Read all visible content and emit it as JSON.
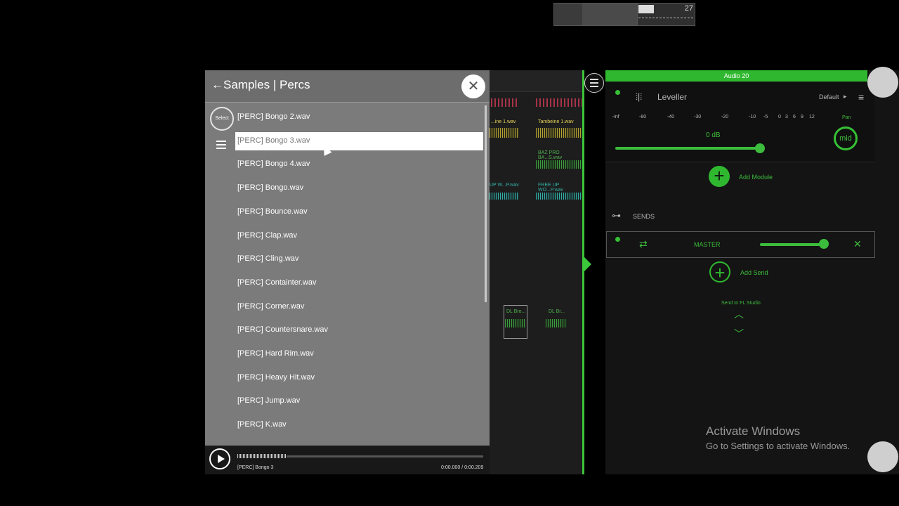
{
  "mini_window": {
    "counter": "27"
  },
  "samples_panel": {
    "title": "Samples | Percs",
    "back_arrow": "←",
    "close_icon": "✕",
    "select_label": "Select",
    "items": [
      "[PERC] Bongo 2.wav",
      "[PERC] Bongo 3.wav",
      "[PERC] Bongo 4.wav",
      "[PERC] Bongo.wav",
      "[PERC] Bounce.wav",
      "[PERC] Clap.wav",
      "[PERC] Cling.wav",
      "[PERC] Containter.wav",
      "[PERC] Corner.wav",
      "[PERC] Countersnare.wav",
      "[PERC] Hard Rim.wav",
      "[PERC] Heavy Hit.wav",
      "[PERC] Jump.wav",
      "[PERC] K.wav"
    ],
    "selected_index": 1
  },
  "player": {
    "sample_name": "[PERC] Bongo 3",
    "time": "0:00.000 / 0:00.209"
  },
  "playlist": {
    "clip1": "...ine 1.wav",
    "clip2": "Tambeine 1.wav",
    "clip3": "BAZ PRO BA...S.wav",
    "clip4": "UP W...P.wav",
    "clip5": "FREE UP WO...P.wav",
    "clip6": "DL Bro...",
    "clip7": "DL Br..."
  },
  "mixer": {
    "track_title": "Audio 20",
    "module_name": "Leveller",
    "preset": "Default",
    "db_scale": [
      "-inf",
      "-80",
      "-40",
      "-30",
      "-20",
      "-10",
      "-5",
      "0",
      "3",
      "6",
      "9",
      "12"
    ],
    "pan_label": "Pan",
    "pan_value": "mid",
    "level_value": "0 dB",
    "level_fraction": 0.95,
    "add_module": "Add Module",
    "sends_label": "SENDS",
    "send_target": "MASTER",
    "send_level_fraction": 0.9,
    "add_send": "Add Send",
    "send_to_fl": "Send to FL Studio"
  },
  "windows": {
    "activate_title": "Activate Windows",
    "activate_sub": "Go to Settings to activate Windows."
  },
  "colors": {
    "accent_green": "#2fb82f",
    "panel_gray": "#7b7b7b"
  }
}
